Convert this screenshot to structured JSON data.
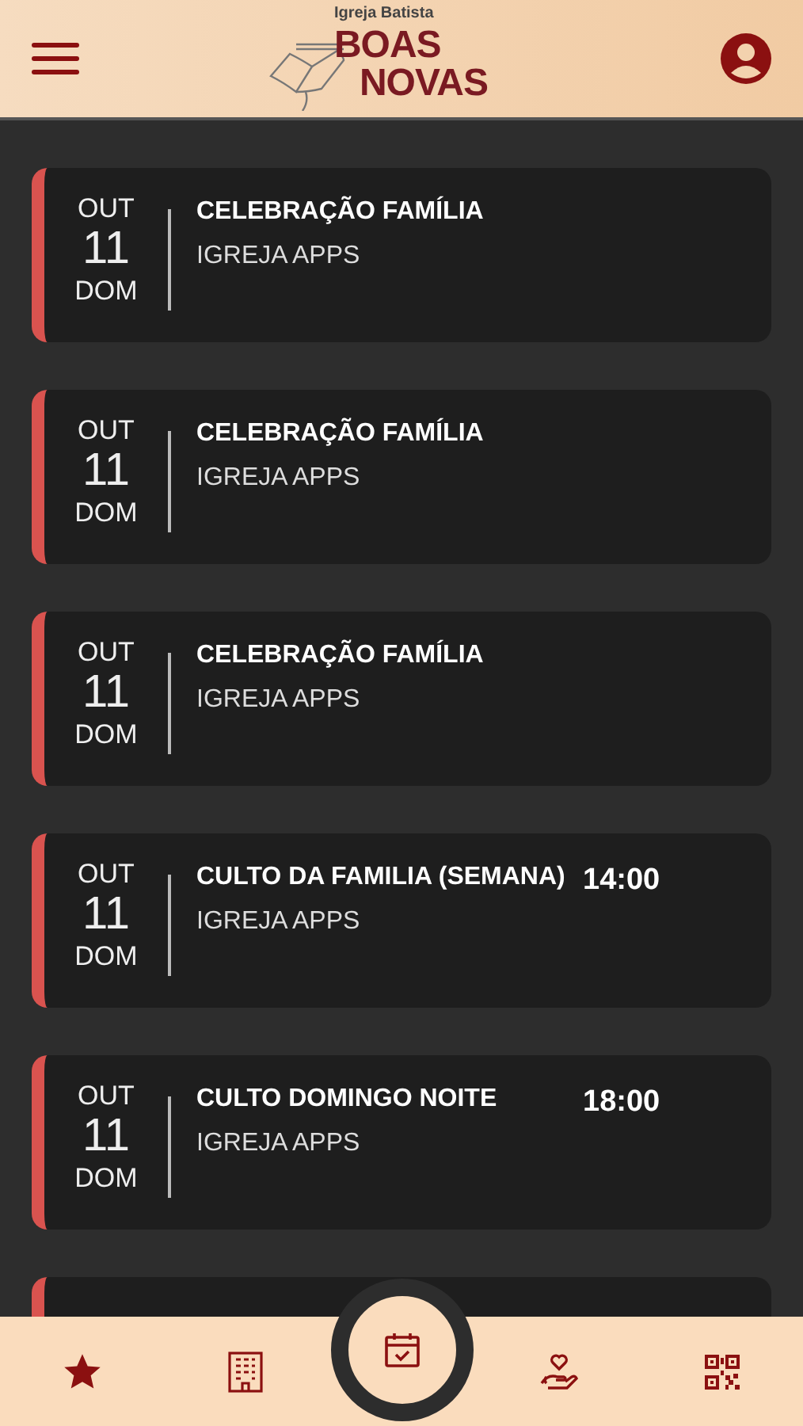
{
  "header": {
    "logo_small": "Igreja Batista",
    "logo_line1": "BOAS",
    "logo_line2": "NOVAS"
  },
  "events": [
    {
      "month": "OUT",
      "day": "11",
      "weekday": "DOM",
      "title": "CELEBRAÇÃO FAMÍLIA",
      "subtitle": "IGREJA APPS"
    },
    {
      "month": "OUT",
      "day": "11",
      "weekday": "DOM",
      "title": "CELEBRAÇÃO FAMÍLIA",
      "subtitle": "IGREJA APPS"
    },
    {
      "month": "OUT",
      "day": "11",
      "weekday": "DOM",
      "title": "CELEBRAÇÃO FAMÍLIA",
      "subtitle": "IGREJA APPS"
    },
    {
      "month": "OUT",
      "day": "11",
      "weekday": "DOM",
      "title": "CULTO DA FAMILIA (SEMANA)",
      "subtitle": "IGREJA APPS",
      "time": "14:00"
    },
    {
      "month": "OUT",
      "day": "11",
      "weekday": "DOM",
      "title": "CULTO DOMINGO NOITE",
      "subtitle": "IGREJA APPS",
      "time": "18:00"
    }
  ],
  "nav": [
    {
      "kind": "star",
      "selected": false
    },
    {
      "kind": "building",
      "selected": false
    },
    {
      "kind": "calendar",
      "selected": true
    },
    {
      "kind": "charity",
      "selected": false
    },
    {
      "kind": "qrcode",
      "selected": false
    }
  ]
}
